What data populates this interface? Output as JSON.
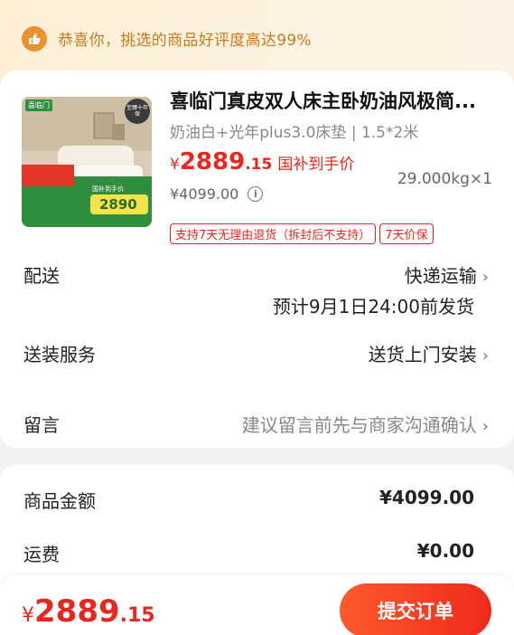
{
  "banner": {
    "text": "恭喜你，挑选的商品好评度高达99%"
  },
  "product": {
    "title": "喜临门真皮双人床主卧奶油风极简...",
    "spec": "奶油白+光年plus3.0床垫 | 1.5*2米",
    "price_yen": "¥",
    "price_int": "2889",
    "price_dec": ".15",
    "price_label": "国补到手价",
    "original_price": "¥4099.00",
    "weight_qty": "29.000kg×1",
    "tags": [
      "支持7天无理由退货（拆封后不支持）",
      "7天价保"
    ],
    "thumb": {
      "brand": "喜临门",
      "badge": "至臻十年保",
      "promo": "国补到手价",
      "promo_price": "2890"
    }
  },
  "shipping": {
    "label": "配送",
    "method": "快递运输",
    "eta": "预计9月1日24:00前发货"
  },
  "install": {
    "label": "送装服务",
    "value": "送货上门安装"
  },
  "message": {
    "label": "留言",
    "placeholder": "建议留言前先与商家沟通确认"
  },
  "summary": {
    "goods_label": "商品金额",
    "goods_value": "¥4099.00",
    "freight_label": "运费",
    "freight_value": "¥0.00"
  },
  "footer": {
    "total_yen": "¥",
    "total_int": "2889",
    "total_dec": ".15",
    "submit_label": "提交订单"
  },
  "colors": {
    "accent_red": "#e8281e",
    "banner_orange": "#e8932f",
    "banner_bg": "#fdf0d6"
  }
}
